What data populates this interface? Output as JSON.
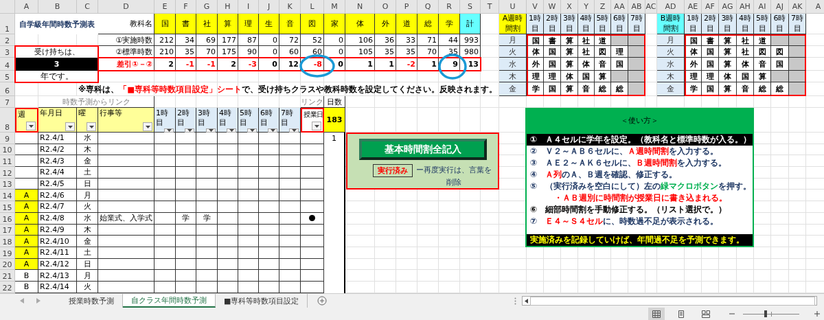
{
  "column_headers": [
    "A",
    "B",
    "C",
    "D",
    "E",
    "F",
    "G",
    "H",
    "I",
    "J",
    "K",
    "L",
    "M",
    "N",
    "O",
    "P",
    "Q",
    "R",
    "S",
    "T",
    "U",
    "V",
    "W",
    "X",
    "Y",
    "Z",
    "AA",
    "AB",
    "AC",
    "AD",
    "AE",
    "AF",
    "AG",
    "AH",
    "AI",
    "AJ",
    "AK",
    "A"
  ],
  "row_headers": [
    "1",
    "2",
    "3",
    "4",
    "5",
    "6",
    "7",
    "8",
    "9",
    "10",
    "11",
    "12",
    "13",
    "14",
    "15",
    "16",
    "17",
    "18",
    "19",
    "20",
    "21",
    "22"
  ],
  "title": "自学級年間時数予測表",
  "grade": {
    "prefix": "受け持ちは、",
    "value": "3",
    "suffix": "年です。"
  },
  "subjects": {
    "label": "教科名",
    "names": [
      "国",
      "書",
      "社",
      "算",
      "理",
      "生",
      "音",
      "図",
      "家",
      "体",
      "外",
      "道",
      "総",
      "学"
    ],
    "total": "計"
  },
  "actual": {
    "label": "①実施時数",
    "values": [
      "212",
      "34",
      "69",
      "177",
      "87",
      "0",
      "72",
      "52",
      "0",
      "106",
      "36",
      "33",
      "71",
      "44",
      "993"
    ]
  },
  "standard": {
    "label": "②標準時数",
    "values": [
      "210",
      "35",
      "70",
      "175",
      "90",
      "0",
      "60",
      "60",
      "0",
      "105",
      "35",
      "35",
      "70",
      "35",
      "980"
    ]
  },
  "difference": {
    "label": "差引①－②",
    "cells": [
      {
        "value": "2",
        "negative": false
      },
      {
        "value": "-1",
        "negative": true
      },
      {
        "value": "-1",
        "negative": true
      },
      {
        "value": "2",
        "negative": false
      },
      {
        "value": "-3",
        "negative": true
      },
      {
        "value": "0",
        "negative": false
      },
      {
        "value": "12",
        "negative": false
      },
      {
        "value": "-8",
        "negative": true
      },
      {
        "value": "0",
        "negative": false
      },
      {
        "value": "1",
        "negative": false
      },
      {
        "value": "1",
        "negative": false
      },
      {
        "value": "-2",
        "negative": true
      },
      {
        "value": "1",
        "negative": false
      },
      {
        "value": "9",
        "negative": false
      },
      {
        "value": "13",
        "negative": false
      }
    ]
  },
  "note": [
    {
      "text": "※専科は、",
      "color": "#000000"
    },
    {
      "text": "「■専科等時数項目設定」シート",
      "color": "#ff0000"
    },
    {
      "text": "で、受け持ちクラスや教科時数を設定してください。反映されます。",
      "color": "#000000"
    }
  ],
  "week_a": {
    "title": "A週時間割",
    "periods": [
      "1時目",
      "2時目",
      "3時目",
      "4時目",
      "5時目",
      "6時目",
      "7時目"
    ],
    "days": [
      {
        "day": "月",
        "subjects": [
          "国",
          "書",
          "算",
          "社",
          "道"
        ]
      },
      {
        "day": "火",
        "subjects": [
          "体",
          "国",
          "算",
          "社",
          "図",
          "理"
        ]
      },
      {
        "day": "水",
        "subjects": [
          "外",
          "国",
          "算",
          "体",
          "音",
          "国"
        ]
      },
      {
        "day": "木",
        "subjects": [
          "理",
          "理",
          "体",
          "国",
          "算"
        ]
      },
      {
        "day": "金",
        "subjects": [
          "学",
          "国",
          "算",
          "音",
          "総",
          "総"
        ]
      }
    ]
  },
  "week_b": {
    "title": "B週時間割",
    "periods": [
      "1時目",
      "2時目",
      "3時目",
      "4時目",
      "5時目",
      "6時目",
      "7時目"
    ],
    "days": [
      {
        "day": "月",
        "subjects": [
          "国",
          "書",
          "算",
          "社",
          "道"
        ]
      },
      {
        "day": "火",
        "subjects": [
          "体",
          "国",
          "算",
          "社",
          "図",
          "図"
        ]
      },
      {
        "day": "水",
        "subjects": [
          "外",
          "国",
          "算",
          "体",
          "音",
          "国"
        ]
      },
      {
        "day": "木",
        "subjects": [
          "理",
          "理",
          "体",
          "国",
          "算"
        ]
      },
      {
        "day": "金",
        "subjects": [
          "学",
          "国",
          "算",
          "音",
          "総",
          "総"
        ]
      }
    ]
  },
  "log": {
    "group_label": "時数予測からリンク",
    "link_label": "リンク",
    "count_label": "日数",
    "day_total": "183",
    "columns": [
      "週",
      "年月日",
      "曜",
      "行事等",
      "1時目",
      "2時目",
      "3時目",
      "4時目",
      "5時目",
      "6時目",
      "7時目",
      "授業日"
    ],
    "rows": [
      {
        "date": "R2.4/1",
        "day": "水",
        "highlighted": false,
        "lesson_day": false,
        "count": "1"
      },
      {
        "date": "R2.4/2",
        "day": "木",
        "highlighted": false,
        "lesson_day": false
      },
      {
        "date": "R2.4/3",
        "day": "金",
        "highlighted": false,
        "lesson_day": false
      },
      {
        "date": "R2.4/4",
        "day": "土",
        "highlighted": false,
        "lesson_day": false
      },
      {
        "date": "R2.4/5",
        "day": "日",
        "highlighted": false,
        "lesson_day": false
      },
      {
        "week": "A",
        "date": "R2.4/6",
        "day": "月",
        "highlighted": true,
        "lesson_day": false
      },
      {
        "week": "A",
        "date": "R2.4/7",
        "day": "火",
        "highlighted": true,
        "lesson_day": false
      },
      {
        "week": "A",
        "date": "R2.4/8",
        "day": "水",
        "highlighted": true,
        "event": "始業式、入学式",
        "periods": [
          {
            "kind": "empty"
          },
          {
            "kind": "lesson",
            "subject": "学"
          },
          {
            "kind": "lesson",
            "subject": "学"
          }
        ],
        "lesson_day": true
      },
      {
        "week": "A",
        "date": "R2.4/9",
        "day": "木",
        "highlighted": true,
        "lesson_day": false
      },
      {
        "week": "A",
        "date": "R2.4/10",
        "day": "金",
        "highlighted": true,
        "lesson_day": false
      },
      {
        "week": "A",
        "date": "R2.4/11",
        "day": "土",
        "highlighted": true,
        "lesson_day": false
      },
      {
        "week": "A",
        "date": "R2.4/12",
        "day": "日",
        "highlighted": true,
        "lesson_day": false
      },
      {
        "week": "B",
        "date": "R2.4/13",
        "day": "月",
        "highlighted": false,
        "lesson_day": false
      },
      {
        "week": "B",
        "date": "R2.4/14",
        "day": "火",
        "highlighted": false,
        "lesson_day": false
      }
    ]
  },
  "macro": {
    "button": "基本時間割全記入",
    "status": "実行済み",
    "hint": "ー再度実行は、言葉を削除"
  },
  "instructions": {
    "title": "＜使い方＞",
    "lines": [
      {
        "kind": "banner",
        "parts": [
          {
            "text": "①　Ａ４セルに学年を設定。（教科名と標準時数が入る。）"
          }
        ]
      },
      {
        "kind": "step",
        "parts": [
          {
            "text": "②　Ｖ２～ＡＢ６セルに、",
            "color": "#1f3864"
          },
          {
            "text": "Ａ週時間割",
            "color": "#ff0000"
          },
          {
            "text": "を入力する。",
            "color": "#1f3864"
          }
        ]
      },
      {
        "kind": "step",
        "parts": [
          {
            "text": "③　ＡＥ２～ＡＫ６セルに、",
            "color": "#1f3864"
          },
          {
            "text": "Ｂ週時間割",
            "color": "#ff0000"
          },
          {
            "text": "を入力する。",
            "color": "#1f3864"
          }
        ]
      },
      {
        "kind": "step",
        "parts": [
          {
            "text": "④　",
            "color": "#1f3864"
          },
          {
            "text": "Ａ列",
            "color": "#ff0000"
          },
          {
            "text": "のＡ、Ｂ週を確認、修正する。",
            "color": "#1f3864"
          }
        ]
      },
      {
        "kind": "step",
        "parts": [
          {
            "text": "⑤　（実行済みを空白にして）左の",
            "color": "#1f3864"
          },
          {
            "text": "緑マクロボタン",
            "color": "#00b050"
          },
          {
            "text": "を押す。",
            "color": "#1f3864"
          }
        ]
      },
      {
        "kind": "sub",
        "parts": [
          {
            "text": "・ＡＢ週別に時間割が授業日に書き込まれる。",
            "color": "#ff0000"
          }
        ]
      },
      {
        "kind": "step",
        "parts": [
          {
            "text": "⑥　細部時間割を手動修正する。（リスト選択で。）",
            "color": "#000000"
          }
        ]
      },
      {
        "kind": "step",
        "parts": [
          {
            "text": "⑦　",
            "color": "#1f3864"
          },
          {
            "text": "Ｅ４～Ｓ４セル",
            "color": "#ff0000"
          },
          {
            "text": "に、時数過不足が表示される。",
            "color": "#1f3864"
          }
        ]
      }
    ],
    "footer": "実施済みを記録していけば、年間過不足を予測できます。"
  },
  "tabs": [
    {
      "label": "授業時数予測",
      "selected": false
    },
    {
      "label": "自クラス年間時数予測",
      "selected": true
    },
    {
      "label": "■専科等時数項目設定",
      "selected": false
    }
  ],
  "status_bar": {
    "views": [
      {
        "selected": true
      },
      {
        "selected": false
      },
      {
        "selected": false
      }
    ],
    "zoom": {
      "level": 0.4
    }
  }
}
